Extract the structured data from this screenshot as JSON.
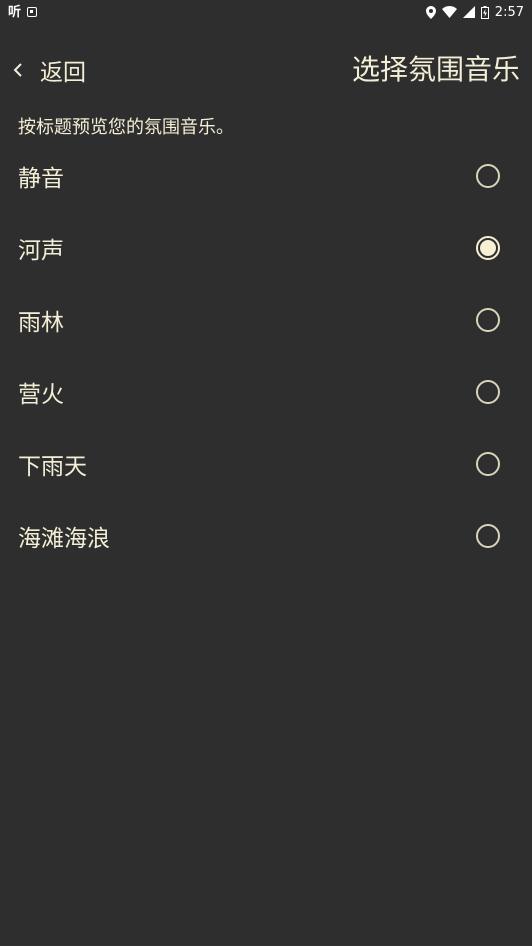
{
  "status_bar": {
    "app_text": "听",
    "time": "2:57"
  },
  "header": {
    "back_label": "返回",
    "title": "选择氛围音乐"
  },
  "subtitle": "按标题预览您的氛围音乐。",
  "options": [
    {
      "label": "静音",
      "selected": false
    },
    {
      "label": "河声",
      "selected": true
    },
    {
      "label": "雨林",
      "selected": false
    },
    {
      "label": "营火",
      "selected": false
    },
    {
      "label": "下雨天",
      "selected": false
    },
    {
      "label": "海滩海浪",
      "selected": false
    }
  ],
  "colors": {
    "background": "#2e2e2e",
    "text": "#f3eed6",
    "accent": "#f6f1d4"
  }
}
